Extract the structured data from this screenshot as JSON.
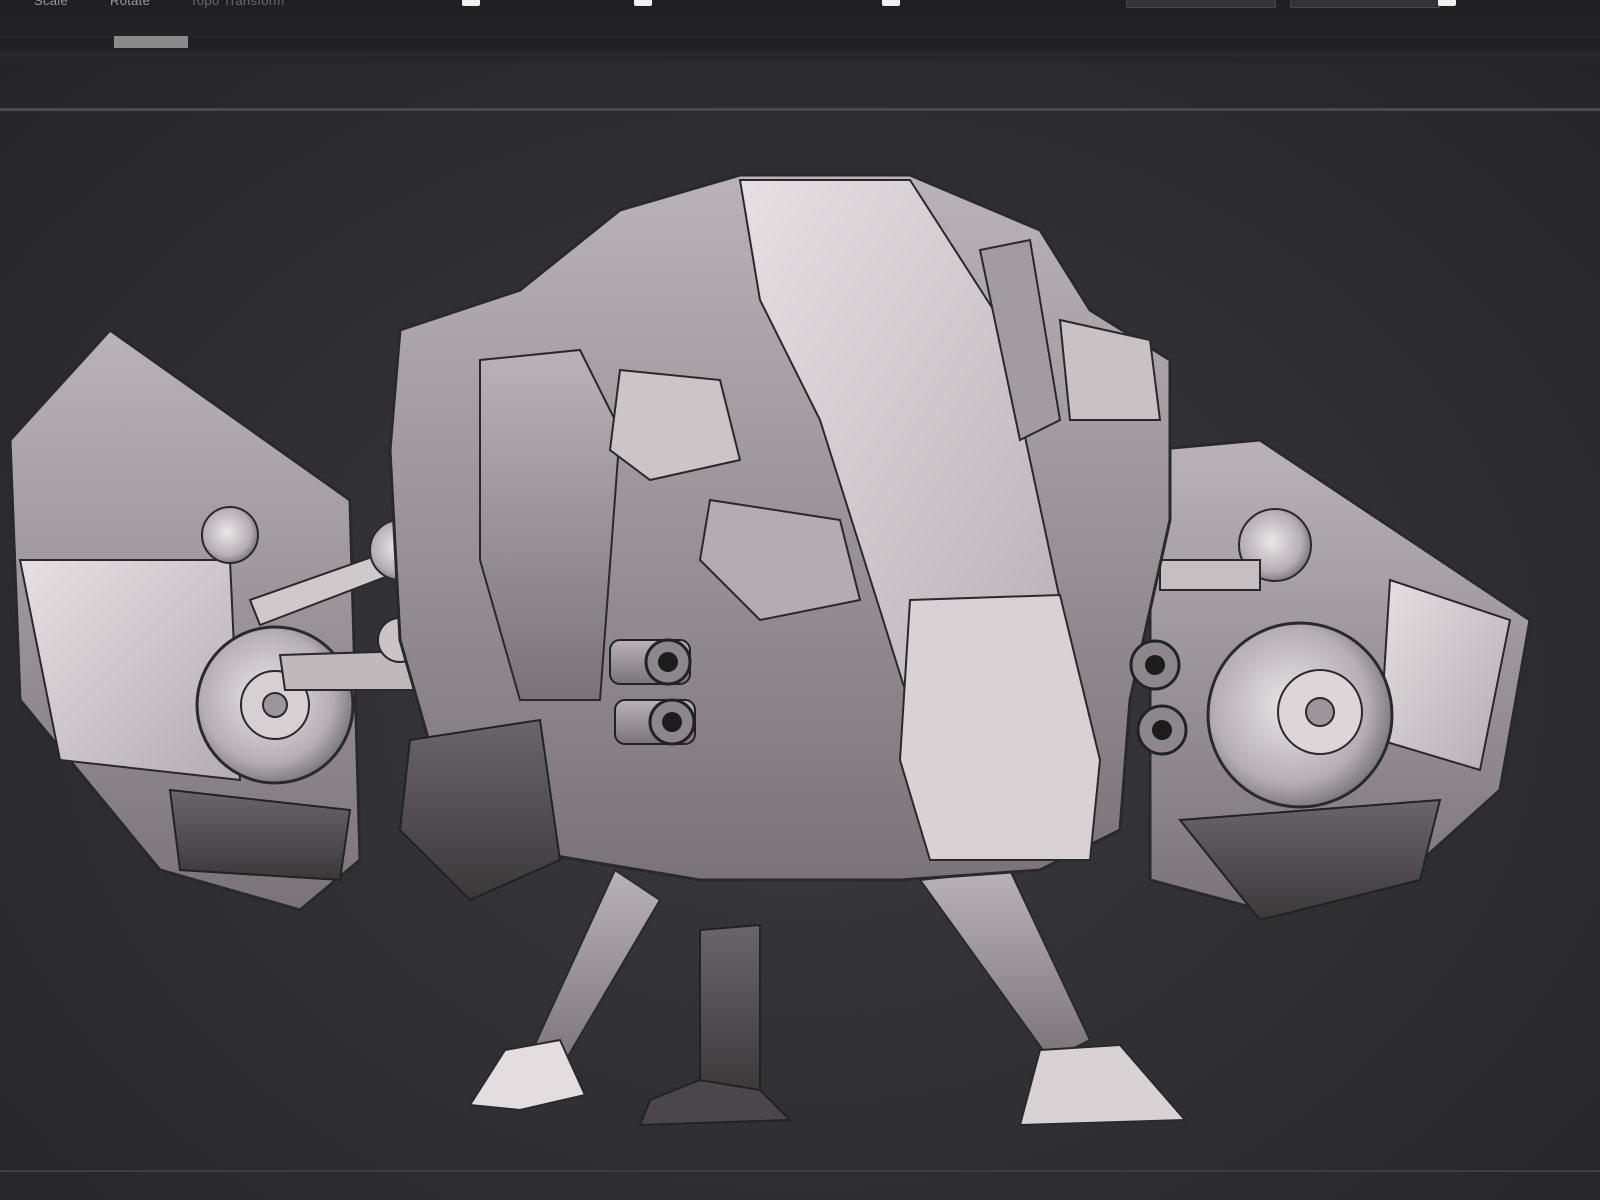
{
  "toolbar": {
    "buttons": [
      {
        "label": "Scale"
      },
      {
        "label": "Rotate"
      },
      {
        "label": "Topo Transform"
      }
    ]
  },
  "viewport": {
    "model": "mech-robot-sculpt"
  },
  "colors": {
    "background": "#2c2c2e",
    "model_light": "#d9d3d6",
    "model_mid": "#a7a1a5",
    "model_dark": "#4d494c"
  }
}
